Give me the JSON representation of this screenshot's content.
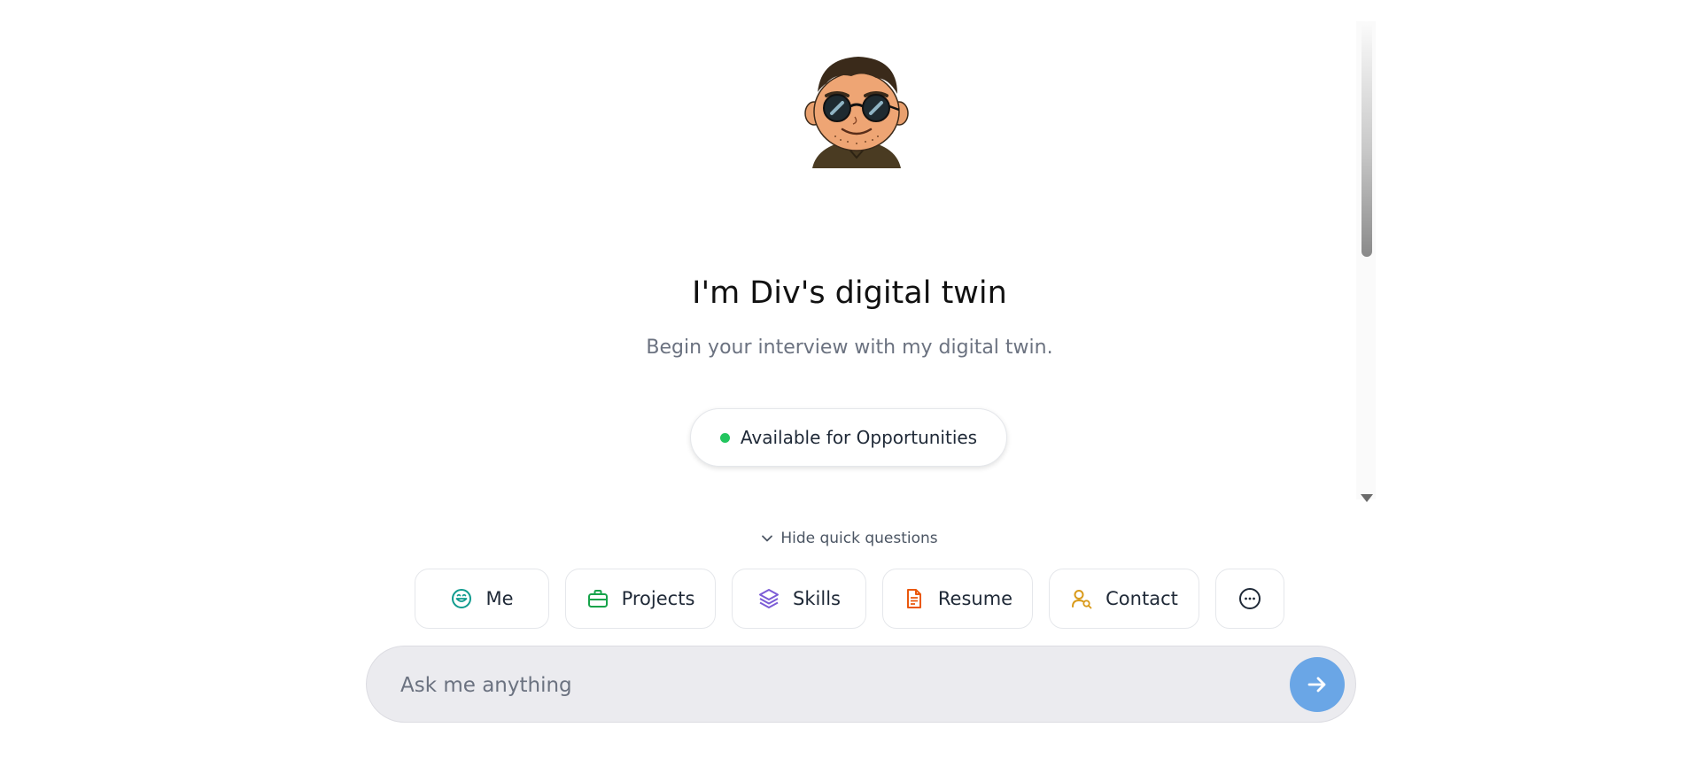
{
  "hero": {
    "avatar_icon": "cartoon-avatar-sunglasses",
    "title": "I'm Div's digital twin",
    "subtitle": "Begin your interview with my digital twin."
  },
  "status": {
    "label": "Available for Opportunities",
    "dot_color": "#22c55e"
  },
  "quick_questions": {
    "toggle_label": "Hide quick questions",
    "toggle_icon": "chevron-down-icon",
    "buttons": [
      {
        "label": "Me",
        "icon": "smile-icon",
        "color": "#0f9b8e"
      },
      {
        "label": "Projects",
        "icon": "briefcase-icon",
        "color": "#16a34a"
      },
      {
        "label": "Skills",
        "icon": "layers-icon",
        "color": "#7c5cd6"
      },
      {
        "label": "Resume",
        "icon": "document-icon",
        "color": "#ea580c"
      },
      {
        "label": "Contact",
        "icon": "user-search-icon",
        "color": "#d99a1a"
      },
      {
        "label": "",
        "icon": "more-icon",
        "color": "#1f2937"
      }
    ]
  },
  "chat_input": {
    "placeholder": "Ask me anything",
    "value": "",
    "send_icon": "arrow-right-icon",
    "send_color": "#6aa6e6"
  }
}
